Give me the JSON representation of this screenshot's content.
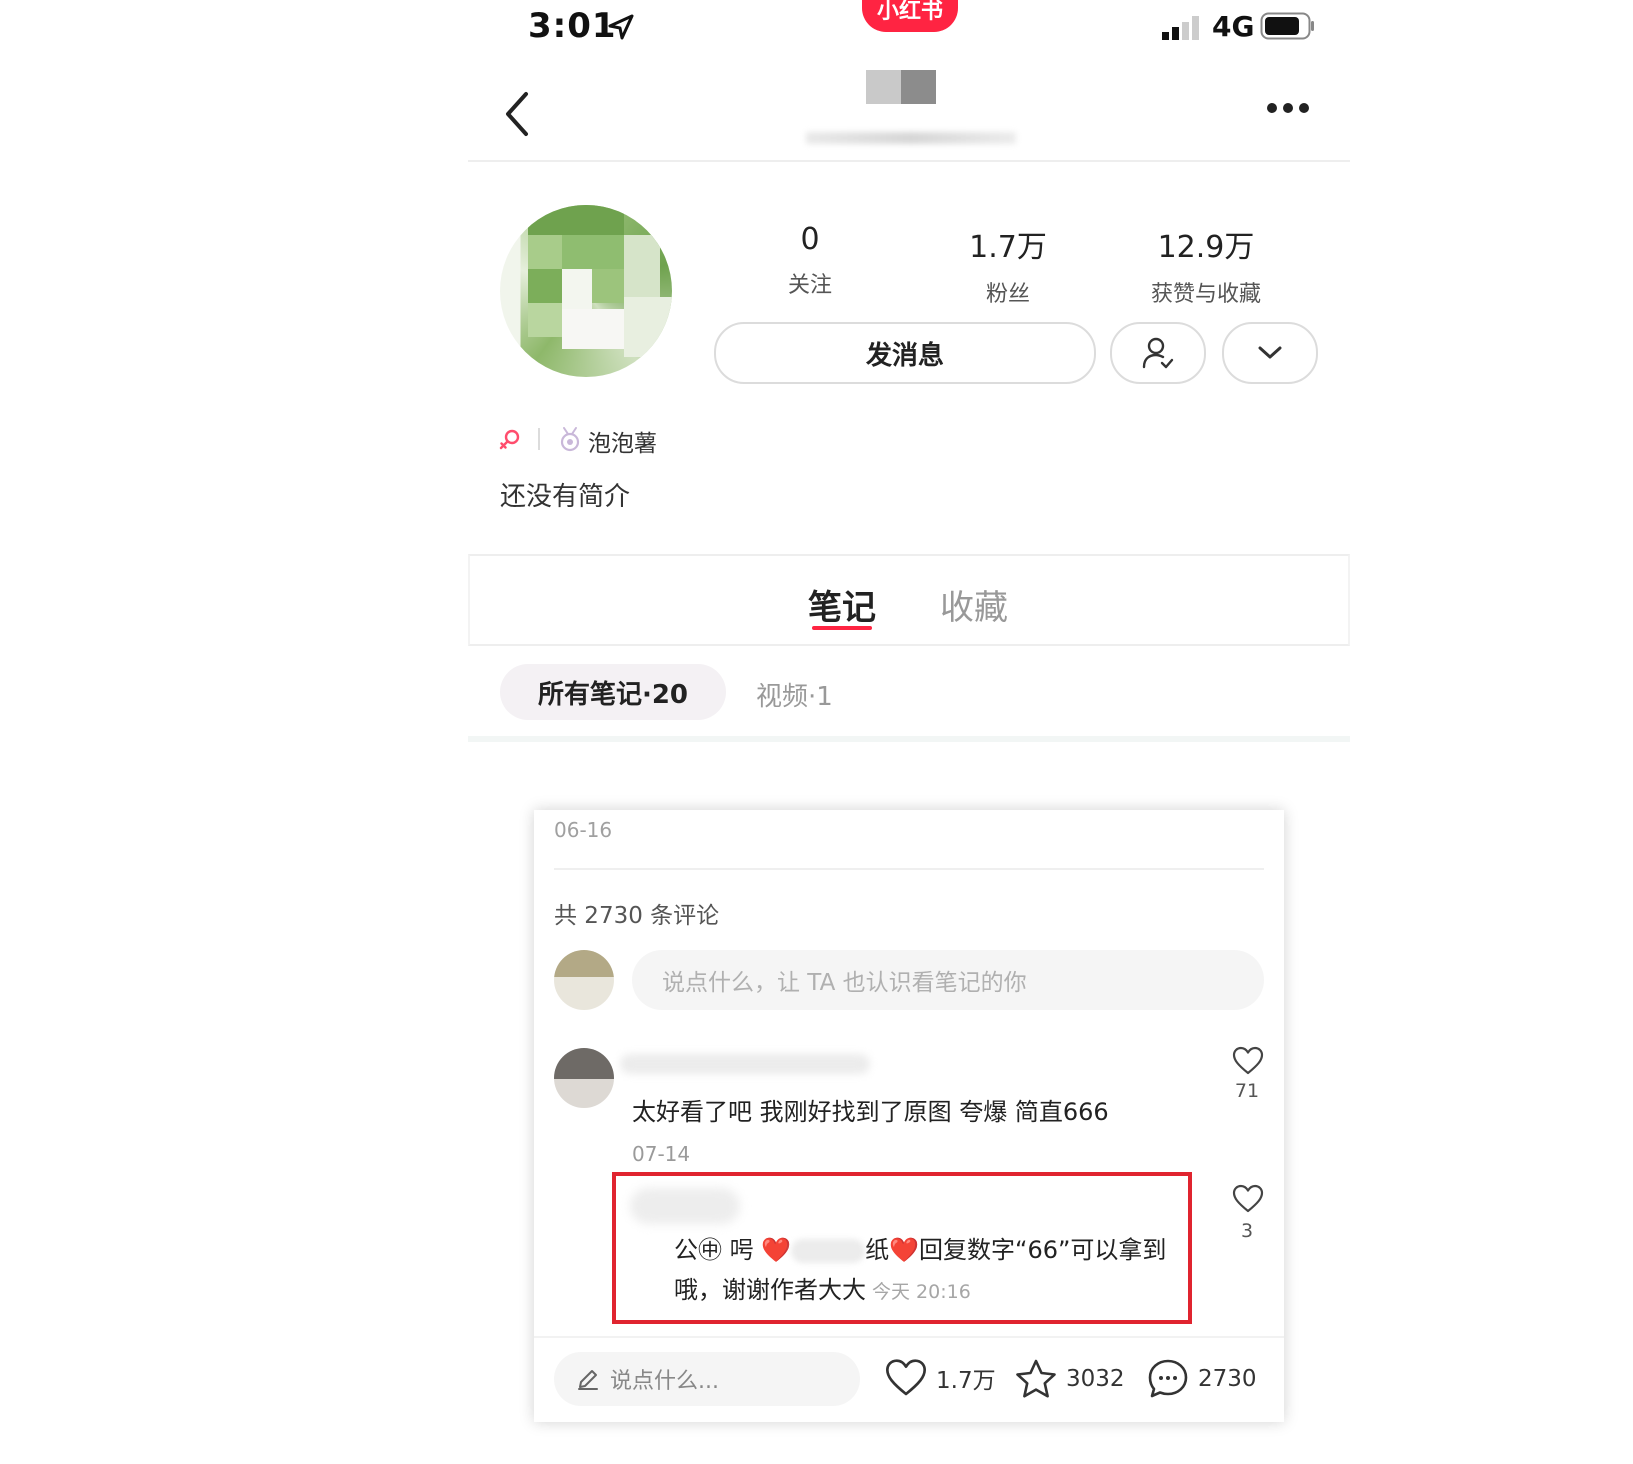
{
  "status_bar": {
    "time": "3:01",
    "network": "4G",
    "brand_badge": "小红书"
  },
  "profile": {
    "stats": [
      {
        "value": "0",
        "label": "关注"
      },
      {
        "value": "1.7万",
        "label": "粉丝"
      },
      {
        "value": "12.9万",
        "label": "获赞与收藏"
      }
    ],
    "message_button": "发消息",
    "level_name": "泡泡薯",
    "bio": "还没有简介"
  },
  "tabs": {
    "notes": "笔记",
    "collections": "收藏"
  },
  "filters": {
    "all_notes": "所有笔记·20",
    "videos": "视频·1"
  },
  "embedded_note": {
    "date": "06-16",
    "comment_count": "共 2730 条评论",
    "input_placeholder": "说点什么，让 TA 也认识看笔记的你",
    "comments": [
      {
        "text": "太好看了吧 我刚好找到了原图 夸爆 简直666",
        "date": "07-14",
        "likes": "71"
      },
      {
        "text_part1": "公㊥ 呺 ❤️",
        "text_part2": "纸❤️回复数字“66”可以拿到哦，谢谢作者大大",
        "time": "今天 20:16",
        "likes": "3"
      }
    ],
    "bottom_bar": {
      "placeholder": "说点什么...",
      "likes": "1.7万",
      "stars": "3032",
      "comments": "2730"
    }
  }
}
